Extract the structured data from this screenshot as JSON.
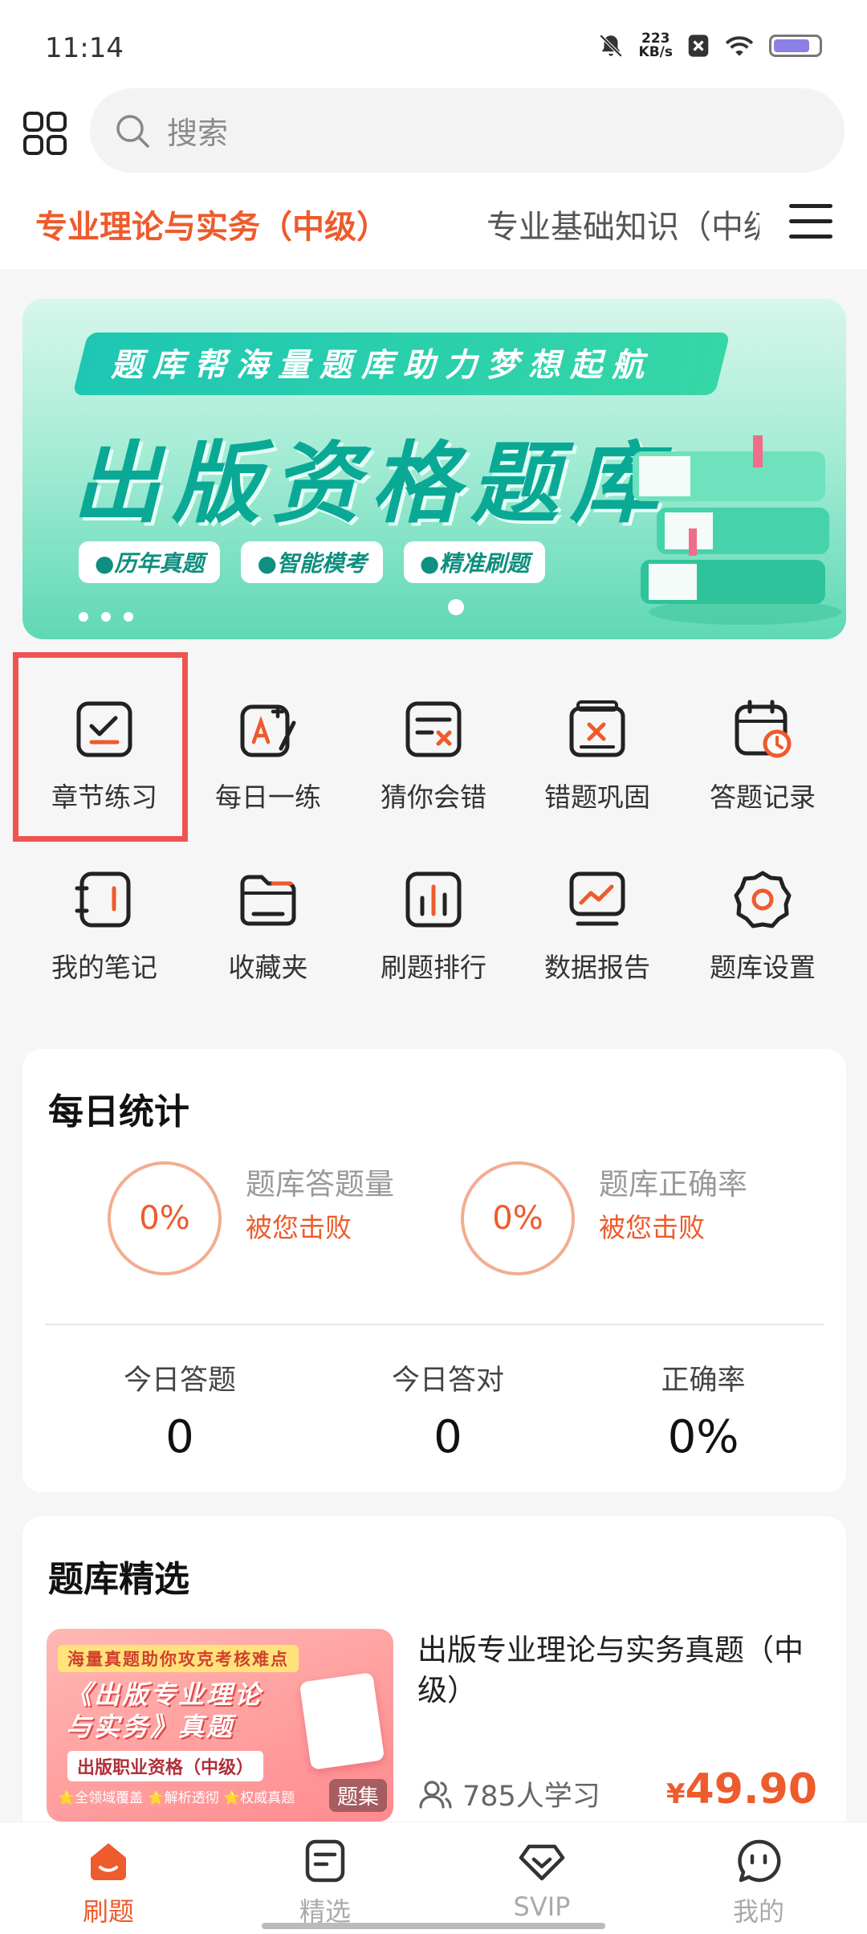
{
  "status_bar": {
    "time": "11:14",
    "net_speed_value": "223",
    "net_speed_unit": "KB/s"
  },
  "search": {
    "placeholder": "搜索"
  },
  "subjects": {
    "active": "专业理论与实务（中级）",
    "other": "专业基础知识（中级）"
  },
  "banner": {
    "ribbon": "题库帮海量题库助力梦想起航",
    "title": "出版资格题库",
    "tags": [
      "●历年真题",
      "●智能模考",
      "●精准刷题"
    ]
  },
  "functions": [
    {
      "label": "章节练习",
      "icon": "chapter-practice-icon"
    },
    {
      "label": "每日一练",
      "icon": "daily-practice-icon"
    },
    {
      "label": "猜你会错",
      "icon": "guess-wrong-icon"
    },
    {
      "label": "错题巩固",
      "icon": "wrong-review-icon"
    },
    {
      "label": "答题记录",
      "icon": "answer-record-icon"
    },
    {
      "label": "我的笔记",
      "icon": "notes-icon"
    },
    {
      "label": "收藏夹",
      "icon": "folder-icon"
    },
    {
      "label": "刷题排行",
      "icon": "ranking-icon"
    },
    {
      "label": "数据报告",
      "icon": "report-icon"
    },
    {
      "label": "题库设置",
      "icon": "settings-icon"
    }
  ],
  "daily_stats": {
    "title": "每日统计",
    "volume": {
      "percent": "0%",
      "label": "题库答题量",
      "sub": "被您击败"
    },
    "accuracy": {
      "percent": "0%",
      "label": "题库正确率",
      "sub": "被您击败"
    },
    "today": [
      {
        "label": "今日答题",
        "value": "0"
      },
      {
        "label": "今日答对",
        "value": "0"
      },
      {
        "label": "正确率",
        "value": "0%"
      }
    ]
  },
  "selection": {
    "title": "题库精选",
    "product": {
      "thumb_top": "海量真题助你攻克考核难点",
      "thumb_title_1": "《出版专业理论",
      "thumb_title_2": "与实务》真题",
      "thumb_level": "出版职业资格（中级）",
      "thumb_features": "⭐全领域覆盖 ⭐解析透彻 ⭐权威真题",
      "thumb_badge": "题集",
      "name": "出版专业理论与实务真题（中级）",
      "learners": "785人学习",
      "price_symbol": "¥",
      "price": "49.90"
    }
  },
  "bottom_nav": [
    {
      "label": "刷题",
      "active": true
    },
    {
      "label": "精选",
      "active": false
    },
    {
      "label": "SVIP",
      "active": false
    },
    {
      "label": "我的",
      "active": false
    }
  ],
  "colors": {
    "accent": "#ee5b2c",
    "highlight": "#ef5450",
    "banner_teal": "#0aa996"
  }
}
